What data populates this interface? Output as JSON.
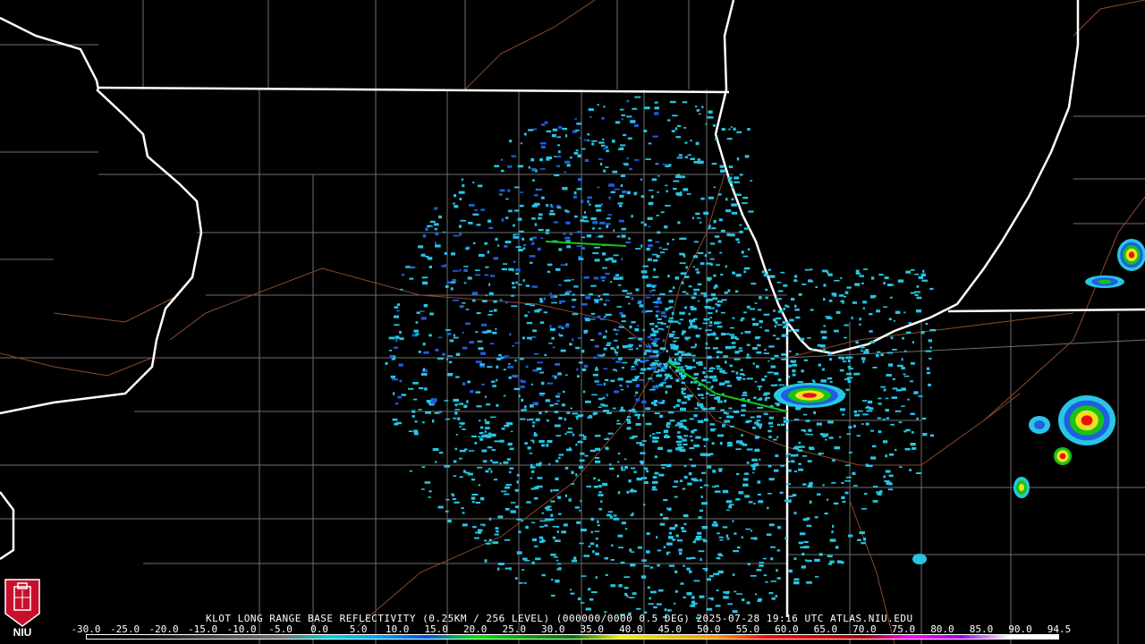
{
  "product": {
    "caption": "KLOT LONG RANGE BASE REFLECTIVITY (0.25KM / 256 LEVEL) (000000/0000 0.5 DEG) 2025-07-28 19:16 UTC  ATLAS.NIU.EDU",
    "station": "KLOT",
    "timestamp": "2025-07-28 19:16 UTC",
    "source": "ATLAS.NIU.EDU"
  },
  "scale": {
    "labels": [
      "-30.0",
      "-25.0",
      "-20.0",
      "-15.0",
      "-10.0",
      "-5.0",
      "0.0",
      "5.0",
      "10.0",
      "15.0",
      "20.0",
      "25.0",
      "30.0",
      "35.0",
      "40.0",
      "45.0",
      "50.0",
      "55.0",
      "60.0",
      "65.0",
      "70.0",
      "75.0",
      "80.0",
      "85.0",
      "90.0",
      "94.5"
    ],
    "colors": {
      "bg": "#000000",
      "state_border": "#ffffff",
      "county_line": "#6e6e6e",
      "road": "#8b4a2b",
      "echo_light": "#27c6e6",
      "echo_mid": "#1f5fe0",
      "echo_green": "#17c317",
      "echo_yellow": "#f0e020",
      "echo_red": "#e81010"
    }
  },
  "logo": {
    "text": "NIU",
    "icon": "niu-tower-logo"
  }
}
